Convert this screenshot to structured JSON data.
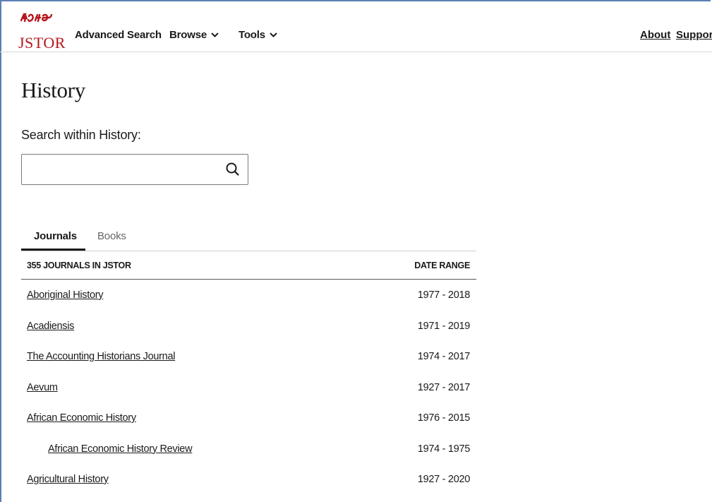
{
  "header": {
    "logo_text": "JSTOR",
    "nav": [
      {
        "label": "Advanced Search"
      },
      {
        "label": "Browse"
      },
      {
        "label": "Tools"
      }
    ],
    "right_links": [
      {
        "label": "About"
      },
      {
        "label": "Suppor"
      }
    ],
    "brand_color": "#b5161b"
  },
  "main": {
    "title": "History",
    "search_label": "Search within History:",
    "search_value": "",
    "search_placeholder": "",
    "tabs": [
      {
        "label": "Journals",
        "active": true
      },
      {
        "label": "Books",
        "active": false
      }
    ],
    "table": {
      "header_left": "355 JOURNALS IN JSTOR",
      "header_right": "DATE RANGE",
      "rows": [
        {
          "title": "Aboriginal History",
          "range": "1977 - 2018"
        },
        {
          "title": "Acadiensis",
          "range": "1971 - 2019"
        },
        {
          "title": "The Accounting Historians Journal",
          "range": "1974 - 2017"
        },
        {
          "title": "Aevum",
          "range": "1927 - 2017"
        },
        {
          "title": "African Economic History",
          "range": "1976 - 2015"
        },
        {
          "title": "African Economic History Review",
          "range": "1974 - 1975"
        },
        {
          "title": "Agricultural History",
          "range": "1927 - 2020"
        }
      ]
    }
  }
}
